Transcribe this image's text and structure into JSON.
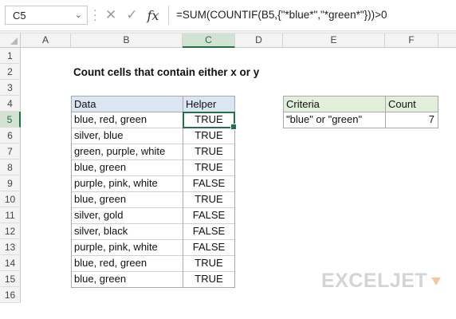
{
  "name_box": {
    "value": "C5"
  },
  "formula_bar": {
    "formula": "=SUM(COUNTIF(B5,{\"*blue*\",\"*green*\"}))>0"
  },
  "columns": [
    "A",
    "B",
    "C",
    "D",
    "E",
    "F"
  ],
  "rows": [
    "1",
    "2",
    "3",
    "4",
    "5",
    "6",
    "7",
    "8",
    "9",
    "10",
    "11",
    "12",
    "13",
    "14",
    "15",
    "16"
  ],
  "active_cell": {
    "column": "C",
    "row": "5"
  },
  "sheet": {
    "title": "Count cells that contain either x or y",
    "table": {
      "headers": [
        "Data",
        "Helper"
      ],
      "rows": [
        [
          "blue, red, green",
          "TRUE"
        ],
        [
          "silver, blue",
          "TRUE"
        ],
        [
          "green, purple, white",
          "TRUE"
        ],
        [
          "blue, green",
          "TRUE"
        ],
        [
          "purple, pink, white",
          "FALSE"
        ],
        [
          "blue, green",
          "TRUE"
        ],
        [
          "silver, gold",
          "FALSE"
        ],
        [
          "silver, black",
          "FALSE"
        ],
        [
          "purple, pink, white",
          "FALSE"
        ],
        [
          "blue, red, green",
          "TRUE"
        ],
        [
          "blue, green",
          "TRUE"
        ]
      ]
    },
    "summary": {
      "headers": [
        "Criteria",
        "Count"
      ],
      "criteria": "\"blue\" or \"green\"",
      "count": "7"
    }
  },
  "logo": {
    "text": "EXCELJET"
  },
  "colors": {
    "selection": "#217346",
    "table_header": "#dce6f3",
    "summary_header": "#e2efda"
  }
}
